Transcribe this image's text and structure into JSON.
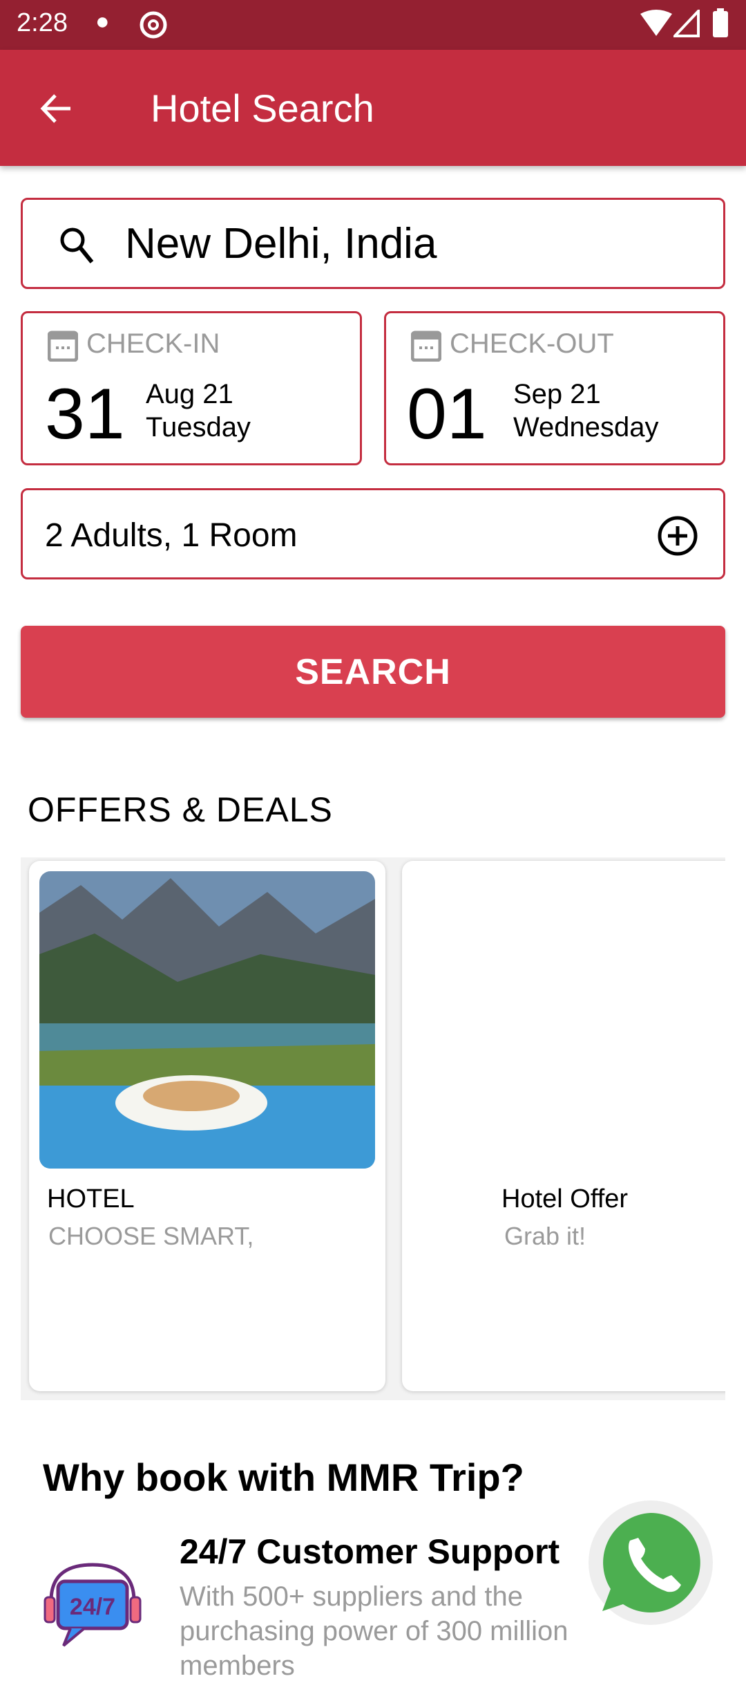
{
  "status_bar": {
    "time": "2:28",
    "icons": [
      "notification-icon",
      "at-sign-icon",
      "wifi-icon",
      "signal-icon",
      "battery-icon"
    ]
  },
  "app_bar": {
    "title": "Hotel Search",
    "back_icon": "arrow-left-icon"
  },
  "search": {
    "value": "New Delhi, India",
    "icon": "search-icon"
  },
  "check_in": {
    "label": "CHECK-IN",
    "day": "31",
    "month_year": "Aug 21",
    "weekday": "Tuesday"
  },
  "check_out": {
    "label": "CHECK-OUT",
    "day": "01",
    "month_year": "Sep 21",
    "weekday": "Wednesday"
  },
  "guests": {
    "value": "2 Adults, 1 Room",
    "icon": "add-circle-icon"
  },
  "search_button": "SEARCH",
  "offers": {
    "heading": "OFFERS & DEALS",
    "cards": [
      {
        "title": "HOTEL",
        "subtitle": "CHOOSE SMART,"
      },
      {
        "title": "Hotel Offer",
        "subtitle": "Grab it!"
      }
    ]
  },
  "why": {
    "heading": "Why book with MMR Trip?",
    "items": [
      {
        "title": "24/7 Customer Support",
        "description": "With 500+ suppliers and the purchasing power of 300 million members"
      }
    ]
  },
  "colors": {
    "primary": "#C42D40",
    "status": "#942031",
    "button": "#D94050",
    "whatsapp": "#4CAF50"
  }
}
